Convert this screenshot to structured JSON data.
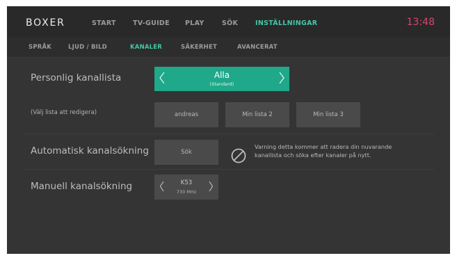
{
  "header": {
    "logo": "BOXER",
    "tabs": [
      {
        "label": "START"
      },
      {
        "label": "TV-GUIDE"
      },
      {
        "label": "PLAY"
      },
      {
        "label": "SÖK"
      },
      {
        "label": "INSTÄLLNINGAR"
      }
    ],
    "active_tab": "INSTÄLLNINGAR",
    "clock": "13:48"
  },
  "subnav": {
    "tabs": [
      {
        "label": "SPRÅK"
      },
      {
        "label": "LJUD / BILD"
      },
      {
        "label": "KANALER"
      },
      {
        "label": "SÄKERHET"
      },
      {
        "label": "AVANCERAT"
      }
    ],
    "active_tab": "KANALER"
  },
  "settings": {
    "personal_list": {
      "label": "Personlig kanallista",
      "value": "Alla",
      "sub_value": "(Standard)"
    },
    "edit_list": {
      "label": "(Välj lista att redigera)",
      "options": [
        "andreas",
        "Min lista 2",
        "Min lista 3"
      ]
    },
    "auto_scan": {
      "label": "Automatisk kanalsökning",
      "button": "Sök",
      "warning_line1": "Varning detta kommer att radera din nuvarande",
      "warning_line2": "kanallista och söka efter kanaler på nytt."
    },
    "manual_scan": {
      "label": "Manuell kanalsökning",
      "channel": "K53",
      "frequency": "730 MHz"
    }
  },
  "colors": {
    "accent": "#43c7a4",
    "selected_bg": "#1fa88a",
    "clock": "#d9456d",
    "background": "#343434"
  },
  "icons": {
    "left": "chevron-left-icon",
    "right": "chevron-right-icon",
    "warning": "no-entry-icon"
  }
}
